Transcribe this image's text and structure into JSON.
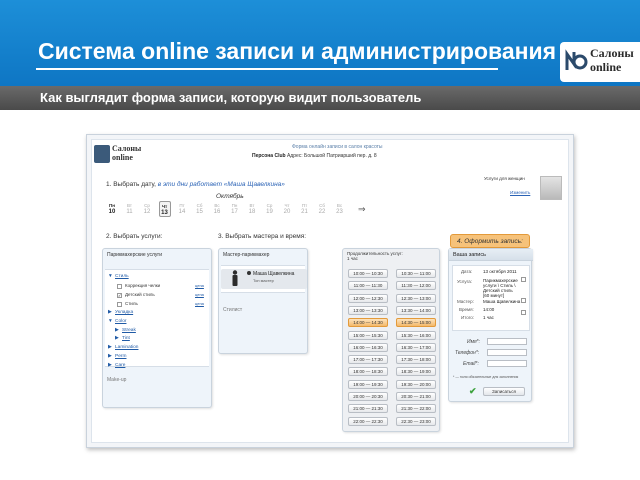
{
  "slide": {
    "title": "Система online записи и администрирования",
    "subtitle": "Как выглядит форма записи, которую видит пользователь",
    "logo_line1": "Салоны",
    "logo_line2": "online"
  },
  "app": {
    "logo_line1": "Салоны",
    "logo_line2": "online",
    "header_line1": "Форма онлайн записи в салон красоты",
    "header_salon": "Персона Club",
    "header_address": "Адрес: Большой Патриарший пер. д. 8",
    "women_label": "Услуги для женщин",
    "change_link": "Изменить",
    "step1_prefix": "1. Выбрать дату,",
    "step1_italic": "в эти дни работает «Маша Щавелкина»",
    "month": "Октябрь",
    "days": [
      {
        "wd": "Пн",
        "num": "10"
      },
      {
        "wd": "Вт",
        "num": "11"
      },
      {
        "wd": "Ср",
        "num": "12"
      },
      {
        "wd": "Чт",
        "num": "13"
      },
      {
        "wd": "Пт",
        "num": "14"
      },
      {
        "wd": "Сб",
        "num": "15"
      },
      {
        "wd": "Вс",
        "num": "16"
      },
      {
        "wd": "Пн",
        "num": "17"
      },
      {
        "wd": "Вт",
        "num": "18"
      },
      {
        "wd": "Ср",
        "num": "19"
      },
      {
        "wd": "Чт",
        "num": "20"
      },
      {
        "wd": "Пт",
        "num": "21"
      },
      {
        "wd": "Сб",
        "num": "22"
      },
      {
        "wd": "Вс",
        "num": "23"
      }
    ],
    "next_arrow": "⇒",
    "step2": "2. Выбрать услуги:",
    "step3": "3. Выбрать мастера и время:",
    "step4": "4. Оформить запись:",
    "services": {
      "header": "Парикмахерские услуги",
      "items": [
        {
          "label": "Стиль",
          "type": "expanded"
        },
        {
          "label": "Коррекция челки",
          "type": "check",
          "link": "цена"
        },
        {
          "label": "Детский стиль",
          "type": "checked",
          "link": "цена"
        },
        {
          "label": "Стиль",
          "type": "check",
          "link": "цена"
        },
        {
          "label": "Укладка",
          "type": "node"
        },
        {
          "label": "Color",
          "type": "expanded"
        },
        {
          "label": "Streak",
          "type": "sub"
        },
        {
          "label": "Tint",
          "type": "sub"
        },
        {
          "label": "Lamination",
          "type": "node"
        },
        {
          "label": "Perm",
          "type": "node"
        },
        {
          "label": "Care",
          "type": "node"
        }
      ],
      "makeup": "Make-up"
    },
    "master": {
      "header": "Мастер-парикмахер",
      "name": "Маша Щавелкина",
      "role": "Топ мастер",
      "stylist": "Стилист"
    },
    "times": {
      "header1": "Продолжительность услуг:",
      "header2": "1 час",
      "slots": [
        [
          "10:00 — 10:30",
          "10:30 — 11:00"
        ],
        [
          "11:00 — 11:30",
          "11:30 — 12:00"
        ],
        [
          "12:00 — 12:30",
          "12:30 — 13:00"
        ],
        [
          "13:00 — 13:30",
          "13:30 — 14:00"
        ],
        [
          "14:00 — 14:30",
          "14:30 — 15:00"
        ],
        [
          "15:00 — 15:30",
          "15:30 — 16:00"
        ],
        [
          "16:00 — 16:30",
          "16:30 — 17:00"
        ],
        [
          "17:00 — 17:30",
          "17:30 — 18:00"
        ],
        [
          "18:00 — 18:30",
          "18:30 — 19:00"
        ],
        [
          "19:00 — 19:30",
          "19:30 — 20:00"
        ],
        [
          "20:00 — 20:30",
          "20:30 — 21:00"
        ],
        [
          "21:00 — 21:30",
          "21:30 — 22:00"
        ],
        [
          "22:00 — 22:30",
          "22:30 — 23:00"
        ]
      ]
    },
    "booking": {
      "header": "Ваша запись",
      "date_label": "Дата:",
      "date_value": "13 октября 2011",
      "service_label": "Услуга:",
      "service_value": "Парикмахерские услуги \\ Стиль \\ Детский стиль [60 минут]",
      "master_label": "Мастер:",
      "master_value": "Маша Щавелкина",
      "time_label": "Время:",
      "time_value": "14:00",
      "total_label": "Итого:",
      "total_value": "1 час",
      "name_label": "Имя*:",
      "phone_label": "Телефон*:",
      "email_label": "Email*:",
      "required_note": "* — поля обязательные для заполнения",
      "submit": "Записаться"
    }
  }
}
